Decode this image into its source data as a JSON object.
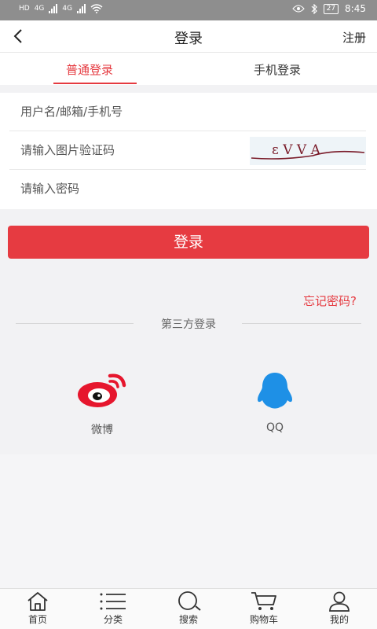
{
  "status_bar": {
    "left_labels": [
      "HD",
      "4G",
      "4G"
    ],
    "battery": "27",
    "time": "8:45"
  },
  "header": {
    "back_icon": "chevron-left-icon",
    "title": "登录",
    "register_label": "注册"
  },
  "tabs": {
    "active_label": "普通登录",
    "other_label": "手机登录"
  },
  "form": {
    "username_placeholder": "用户名/邮箱/手机号",
    "captcha_placeholder": "请输入图片验证码",
    "captcha_image_text": "ɛ V V A",
    "password_placeholder": "请输入密码"
  },
  "login_button_label": "登录",
  "forgot_password_label": "忘记密码?",
  "third_party": {
    "label": "第三方登录",
    "weibo_label": "微博",
    "qq_label": "QQ"
  },
  "bottom_nav": {
    "home": "首页",
    "category": "分类",
    "search": "搜索",
    "cart": "购物车",
    "mine": "我的"
  },
  "colors": {
    "accent": "#e53a40",
    "status_bar": "#8e8e8e",
    "qq_blue": "#1e90e6"
  }
}
